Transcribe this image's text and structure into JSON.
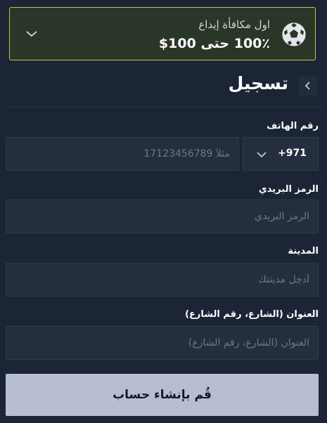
{
  "bonus": {
    "subtitle": "اول مكافأة إيداع",
    "title": "100٪ حتى 100$",
    "icons": {
      "ball": "soccer-ball-icon",
      "toggle": "chevron-down-icon"
    },
    "accent_color": "#b9cf3c"
  },
  "header": {
    "title": "تسجيل",
    "back_icon": "chevron-left-icon"
  },
  "form": {
    "phone": {
      "label": "رقم الهاتف",
      "country_code": "+971",
      "placeholder": "مثلاً 17123456789",
      "value": ""
    },
    "postal_code": {
      "label": "الرمز البريدي",
      "placeholder": "الرمز البريدي",
      "value": ""
    },
    "city": {
      "label": "المدينة",
      "placeholder": "أدخِل مدينتك",
      "value": ""
    },
    "address": {
      "label": "العنوان (الشارع، رقم الشارع)",
      "placeholder": "العنوان (الشارع، رقم الشارع)",
      "value": ""
    },
    "submit_label": "قُم بإنشاء حساب"
  }
}
